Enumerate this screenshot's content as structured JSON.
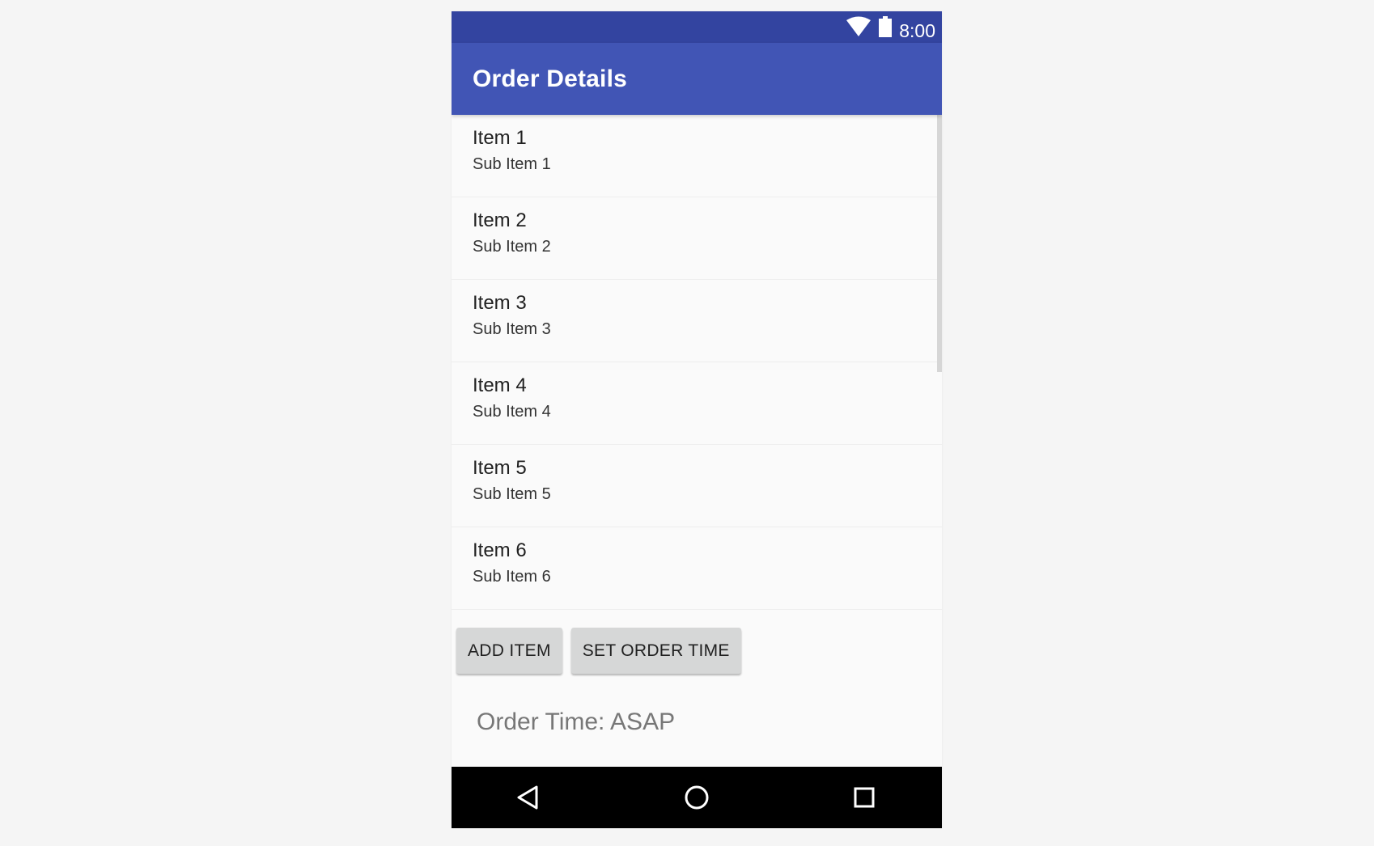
{
  "status_bar": {
    "time": "8:00",
    "icons": [
      "wifi-icon",
      "battery-icon"
    ]
  },
  "app_bar": {
    "title": "Order Details"
  },
  "list": {
    "items": [
      {
        "title": "Item 1",
        "subtitle": "Sub Item 1"
      },
      {
        "title": "Item 2",
        "subtitle": "Sub Item 2"
      },
      {
        "title": "Item 3",
        "subtitle": "Sub Item 3"
      },
      {
        "title": "Item 4",
        "subtitle": "Sub Item 4"
      },
      {
        "title": "Item 5",
        "subtitle": "Sub Item 5"
      },
      {
        "title": "Item 6",
        "subtitle": "Sub Item 6"
      }
    ]
  },
  "actions": {
    "add_item_label": "ADD ITEM",
    "set_order_time_label": "SET ORDER TIME"
  },
  "order_time": {
    "text": "Order Time: ASAP"
  },
  "nav_bar": {
    "icons": [
      "back-icon",
      "home-icon",
      "recents-icon"
    ]
  },
  "colors": {
    "status_bar": "#3344a0",
    "app_bar": "#4155b5",
    "background": "#fafafa",
    "button": "#d6d7d7",
    "nav_bar": "#000000"
  }
}
